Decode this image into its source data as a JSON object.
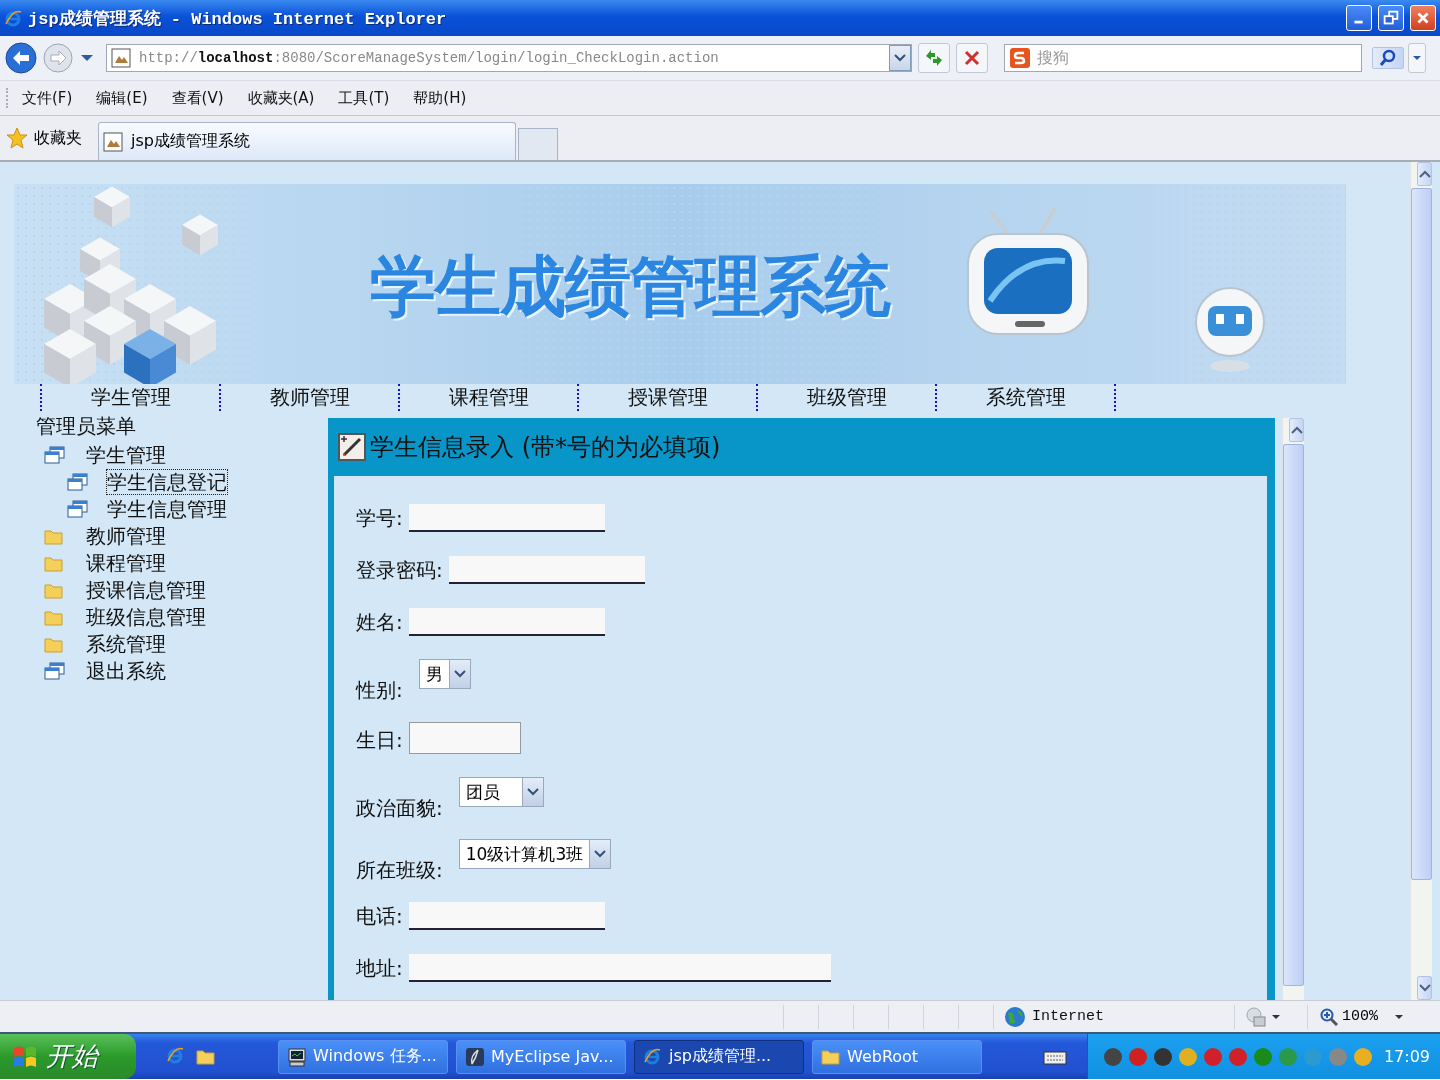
{
  "window": {
    "title": "jsp成绩管理系统 - Windows Internet Explorer"
  },
  "address_bar": {
    "url": "http://**localhost**:8080/ScoreManageSystem/login/login_CheckLogin.action"
  },
  "search": {
    "placeholder": "搜狗"
  },
  "menu_bar": [
    "文件(F)",
    "编辑(E)",
    "查看(V)",
    "收藏夹(A)",
    "工具(T)",
    "帮助(H)"
  ],
  "favorites": {
    "label": "收藏夹"
  },
  "tabs": [
    {
      "label": "jsp成绩管理系统",
      "selected": true
    }
  ],
  "page": {
    "banner_title": "学生成绩管理系统",
    "nav": [
      "学生管理",
      "教师管理",
      "课程管理",
      "授课管理",
      "班级管理",
      "系统管理"
    ],
    "sidebar": {
      "title": "管理员菜单",
      "items": [
        {
          "label": "学生管理",
          "kind": "window",
          "selected": false,
          "children": [
            {
              "label": "学生信息登记",
              "kind": "window",
              "selected": true
            },
            {
              "label": "学生信息管理",
              "kind": "window",
              "selected": false
            }
          ]
        },
        {
          "label": "教师管理",
          "kind": "folder",
          "selected": false
        },
        {
          "label": "课程管理",
          "kind": "folder",
          "selected": false
        },
        {
          "label": "授课信息管理",
          "kind": "folder",
          "selected": false
        },
        {
          "label": "班级信息管理",
          "kind": "folder",
          "selected": false
        },
        {
          "label": "系统管理",
          "kind": "folder",
          "selected": false
        },
        {
          "label": "退出系统",
          "kind": "window",
          "selected": false
        }
      ]
    },
    "form": {
      "title": "学生信息录入 (带*号的为必填项)",
      "fields": [
        {
          "label": "学号:",
          "kind": "text"
        },
        {
          "label": "登录密码:",
          "kind": "text"
        },
        {
          "label": "姓名:",
          "kind": "text"
        },
        {
          "label": "性别:",
          "kind": "select",
          "value": "男"
        },
        {
          "label": "生日:",
          "kind": "date"
        },
        {
          "label": "政治面貌:",
          "kind": "select",
          "value": "团员"
        },
        {
          "label": "所在班级:",
          "kind": "select",
          "value": "10级计算机3班"
        },
        {
          "label": "电话:",
          "kind": "text"
        },
        {
          "label": "地址:",
          "kind": "wide"
        }
      ]
    }
  },
  "status_bar": {
    "zone": "Internet",
    "zoom": "100%"
  },
  "taskbar": {
    "start": "开始",
    "tasks": [
      {
        "label": "Windows 任务...",
        "kind": "monitor",
        "selected": false
      },
      {
        "label": "MyEclipse Jav...",
        "kind": "eclipse",
        "selected": false
      },
      {
        "label": "jsp成绩管理...",
        "kind": "ie",
        "selected": true
      },
      {
        "label": "WebRoot",
        "kind": "folder",
        "selected": false
      }
    ],
    "clock": "17:09"
  }
}
